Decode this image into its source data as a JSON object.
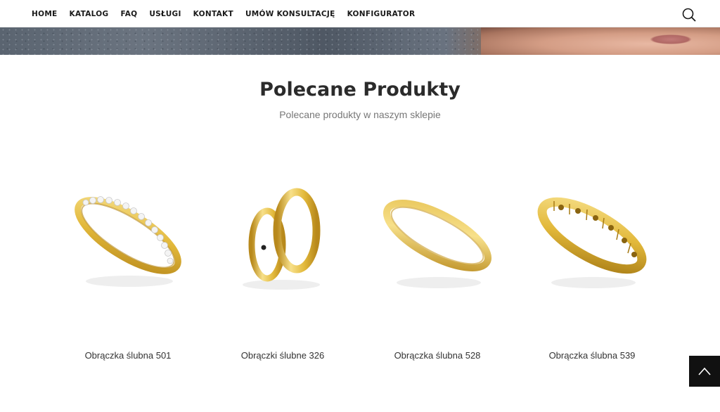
{
  "nav": {
    "items": [
      {
        "label": "HOME"
      },
      {
        "label": "KATALOG"
      },
      {
        "label": "FAQ"
      },
      {
        "label": "USŁUGI"
      },
      {
        "label": "KONTAKT"
      },
      {
        "label": "UMÓW KONSULTACJĘ"
      },
      {
        "label": "KONFIGURATOR"
      }
    ],
    "search_icon": "search-icon"
  },
  "section": {
    "title": "Polecane Produkty",
    "subtitle": "Polecane produkty w naszym sklepie"
  },
  "products": [
    {
      "name": "Obrączka ślubna 501",
      "image": "gold-ring-diamonds"
    },
    {
      "name": "Obrączki ślubne 326",
      "image": "gold-ring-pair"
    },
    {
      "name": "Obrączka ślubna 528",
      "image": "gold-ring-plain"
    },
    {
      "name": "Obrączka ślubna 539",
      "image": "gold-ring-textured"
    }
  ],
  "scroll_top": {
    "icon": "chevron-up-icon"
  },
  "colors": {
    "gold": "#e2b83a",
    "gold_dark": "#b8891c",
    "gold_light": "#f7e08a",
    "button_bg": "#111111"
  }
}
